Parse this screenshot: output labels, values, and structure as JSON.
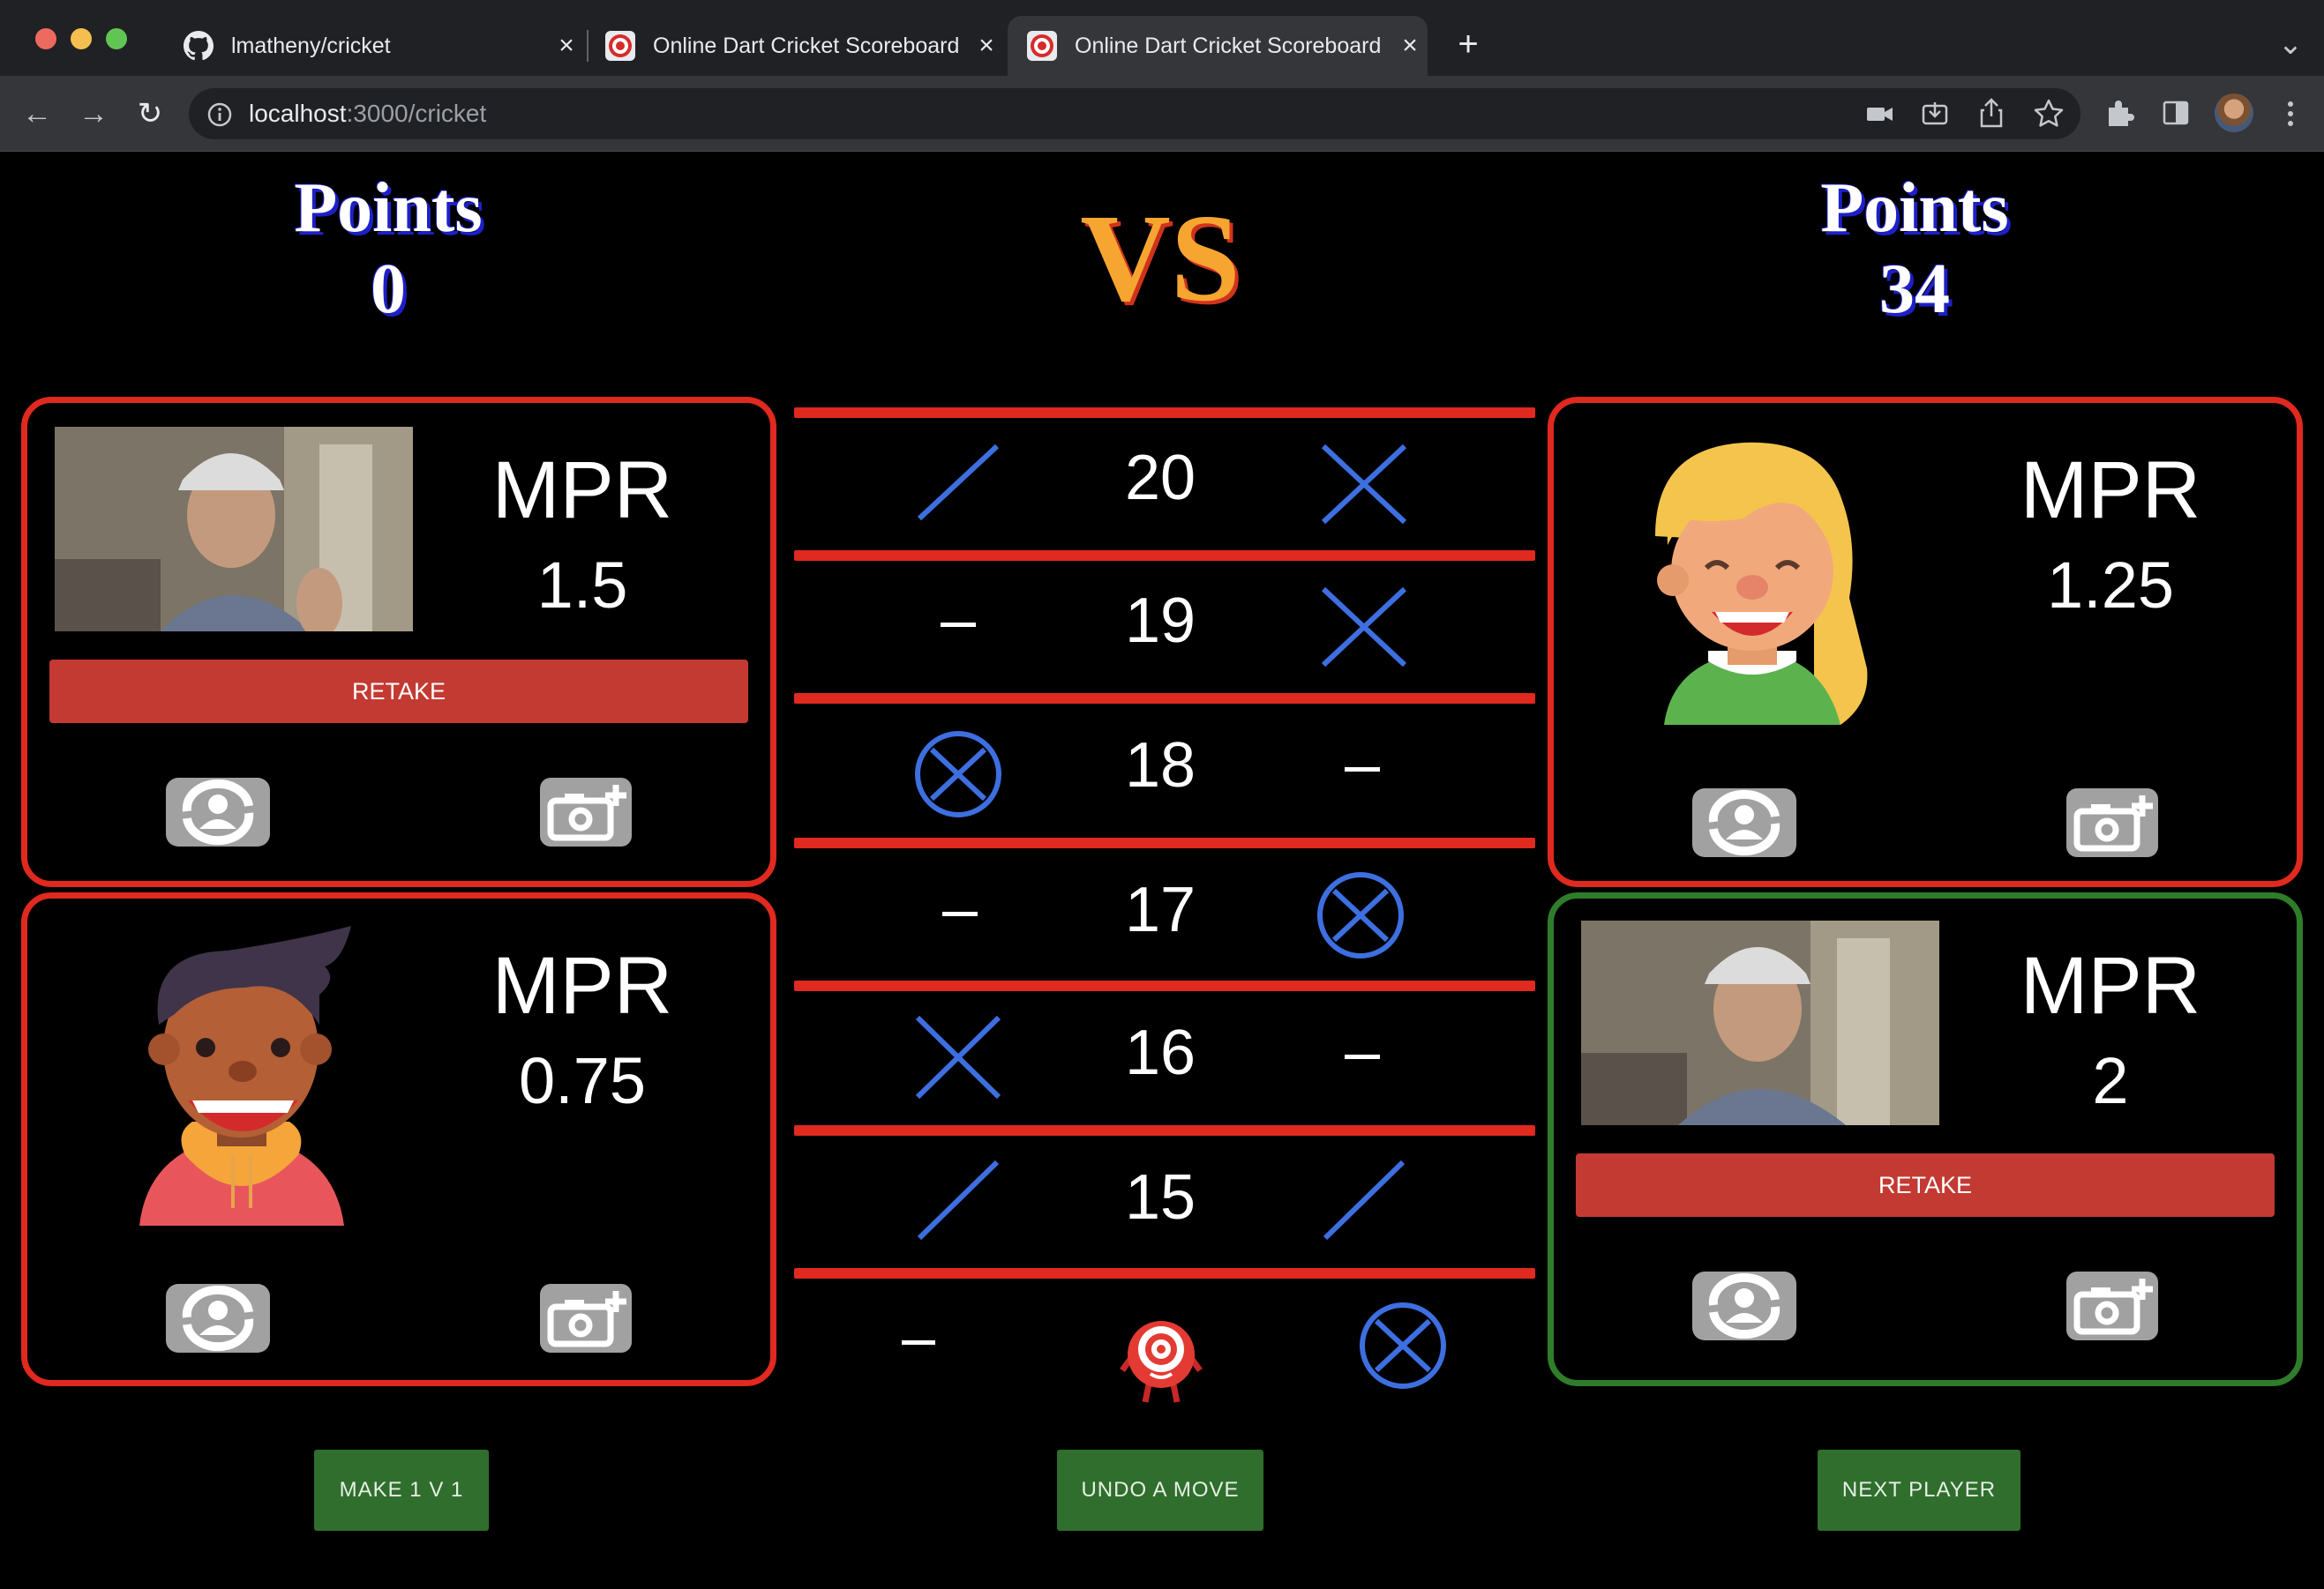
{
  "browser": {
    "tabs": [
      {
        "title": "lmatheny/cricket",
        "active": false
      },
      {
        "title": "Online Dart Cricket Scoreboard",
        "active": false
      },
      {
        "title": "Online Dart Cricket Scoreboard",
        "active": true
      }
    ],
    "url_host": "localhost",
    "url_path": ":3000/cricket",
    "new_tab": "+",
    "tab_menu": "⌄",
    "back": "←",
    "forward": "→",
    "reload": "↻",
    "close": "×"
  },
  "header": {
    "left_points_label": "Points",
    "left_points_value": "0",
    "vs_label": "VS",
    "right_points_label": "Points",
    "right_points_value": "34"
  },
  "players": [
    {
      "slot": "top-left",
      "mpr_label": "MPR",
      "mpr_value": "1.5",
      "retake_label": "RETAKE",
      "avatar": "webcam-photo"
    },
    {
      "slot": "bottom-left",
      "mpr_label": "MPR",
      "mpr_value": "0.75",
      "avatar": "boy-avatar"
    },
    {
      "slot": "top-right",
      "mpr_label": "MPR",
      "mpr_value": "1.25",
      "avatar": "girl-avatar"
    },
    {
      "slot": "bottom-right",
      "mpr_label": "MPR",
      "mpr_value": "2",
      "retake_label": "RETAKE",
      "avatar": "webcam-photo",
      "active": true
    }
  ],
  "board": {
    "rows": [
      {
        "number": "20",
        "left_mark": "slash",
        "right_mark": "x"
      },
      {
        "number": "19",
        "left_mark": "dash",
        "right_mark": "x"
      },
      {
        "number": "18",
        "left_mark": "circle-x",
        "right_mark": "dash"
      },
      {
        "number": "17",
        "left_mark": "dash",
        "right_mark": "circle-x"
      },
      {
        "number": "16",
        "left_mark": "x",
        "right_mark": "dash"
      },
      {
        "number": "15",
        "left_mark": "slash",
        "right_mark": "slash"
      },
      {
        "number": "bull",
        "left_mark": "dash",
        "right_mark": "circle-x"
      }
    ],
    "dash_glyph": "–"
  },
  "controls": {
    "make_1v1": "MAKE 1 V 1",
    "undo": "UNDO A MOVE",
    "next_player": "NEXT PLAYER"
  },
  "colors": {
    "card_border": "#e0291f",
    "active_card_border": "#2f7d2a",
    "mark_blue": "#3d6fe0",
    "retake_red": "#c33a32",
    "action_green": "#2f6e2c"
  }
}
